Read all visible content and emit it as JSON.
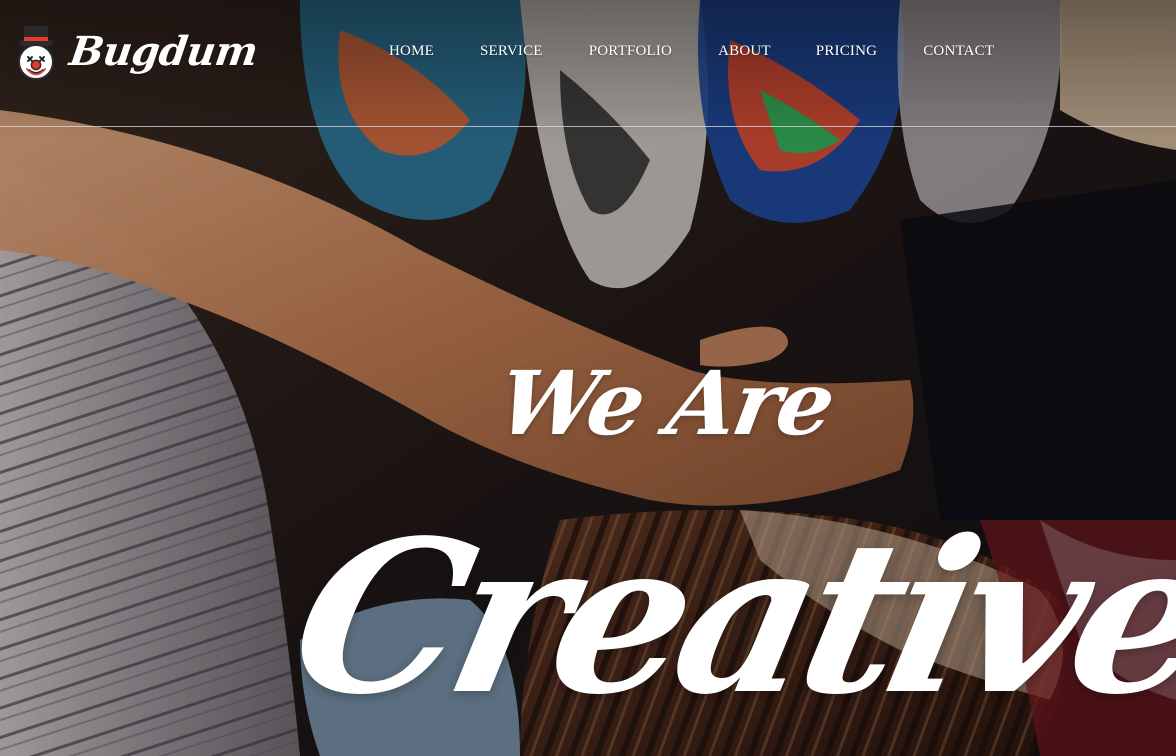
{
  "brand": {
    "name": "Bugdum",
    "logo_icon": "clown-face-top-hat-icon"
  },
  "nav": {
    "items": [
      {
        "label": "HOME"
      },
      {
        "label": "SERVICE"
      },
      {
        "label": "PORTFOLIO"
      },
      {
        "label": "ABOUT"
      },
      {
        "label": "PRICING"
      },
      {
        "label": "CONTACT"
      }
    ]
  },
  "hero": {
    "line1": "We Are",
    "line2": "Creative",
    "background": "photo-hands-drumming-masks"
  },
  "colors": {
    "text": "#ffffff",
    "logo_hat": "#2b2b2b",
    "logo_nose": "#e63a2e",
    "header_rule": "#dcdce1"
  }
}
